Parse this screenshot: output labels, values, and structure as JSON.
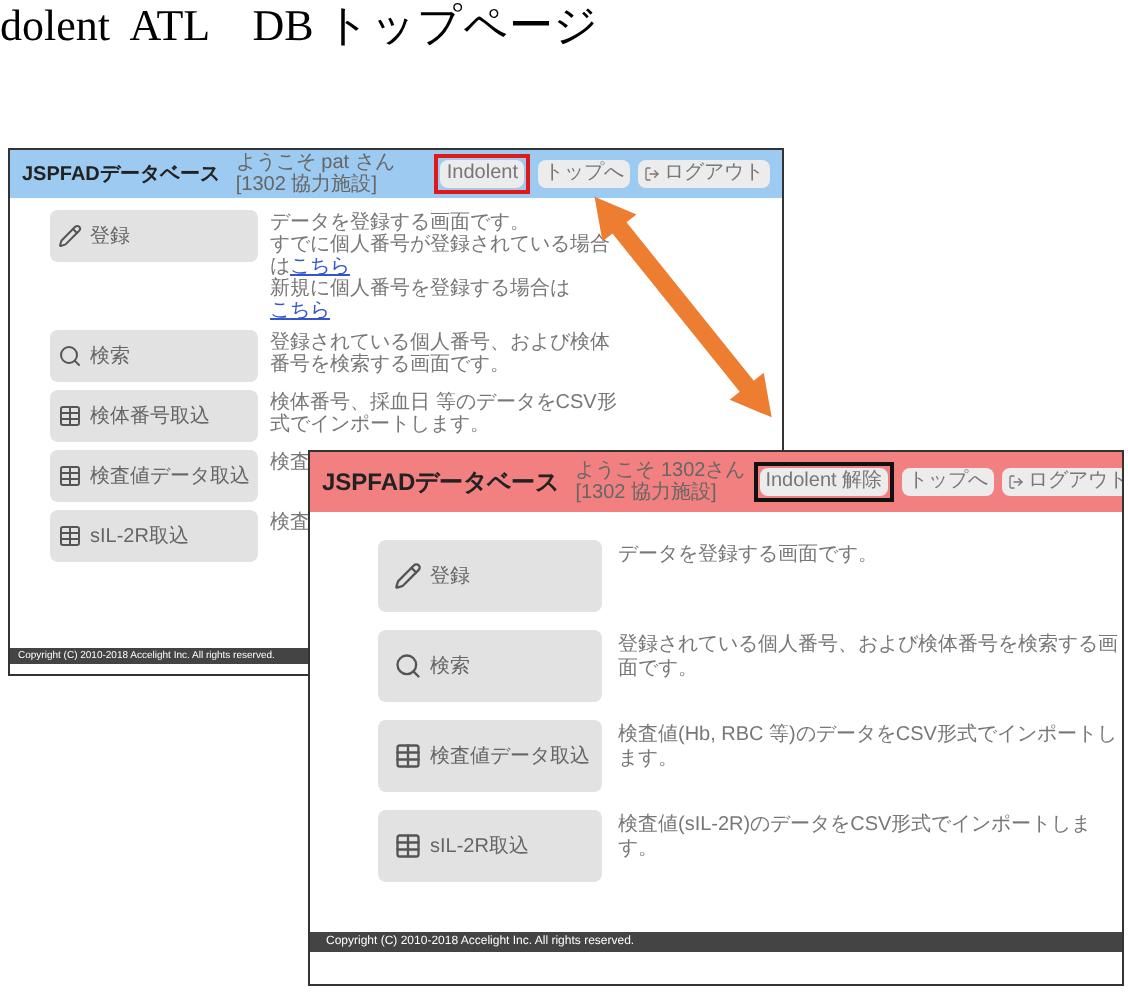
{
  "heading": "dolent  ATL　DB トップページ",
  "screenshots": [
    {
      "kind": "blue",
      "title": "JSPFADデータベース",
      "welcome": "ようこそ pat さん",
      "facility": "[1302 協力施設]",
      "header_buttons": [
        {
          "label": "Indolent",
          "highlighted": true,
          "icon": false
        },
        {
          "label": "トップへ",
          "highlighted": false,
          "icon": false
        },
        {
          "label": "ログアウト",
          "highlighted": false,
          "icon": true
        }
      ],
      "menu": [
        {
          "label": "登録",
          "kind": "pen",
          "description": [
            {
              "text": "データを登録する画面です。"
            },
            {
              "text": "すでに個人番号が登録されている場合は",
              "link": "こちら"
            },
            {
              "text": "新規に個人番号を登録する場合は",
              "link": "こちら"
            }
          ]
        },
        {
          "label": "検索",
          "kind": "search",
          "description": [
            {
              "text": "登録されている個人番号、および検体番号を検索する画面です。"
            }
          ]
        },
        {
          "label": "検体番号取込",
          "kind": "table",
          "description": [
            {
              "text": "検体番号、採血日 等のデータをCSV形式でインポートします。"
            }
          ]
        },
        {
          "label": "検査値データ取込",
          "kind": "table",
          "description": [
            {
              "text": "検査"
            }
          ]
        },
        {
          "label": "sIL-2R取込",
          "kind": "table",
          "description": [
            {
              "text": "検査"
            }
          ]
        }
      ],
      "footer": "Copyright (C) 2010-2018 Accelight Inc. All rights reserved."
    },
    {
      "kind": "pink",
      "title": "JSPFADデータベース",
      "welcome": "ようこそ 1302さん",
      "facility": "[1302 協力施設]",
      "header_buttons": [
        {
          "label": "Indolent 解除",
          "highlighted": true,
          "icon": false
        },
        {
          "label": "トップへ",
          "highlighted": false,
          "icon": false
        },
        {
          "label": "ログアウト",
          "highlighted": false,
          "icon": true
        }
      ],
      "menu": [
        {
          "label": "登録",
          "kind": "pen",
          "description": [
            {
              "text": "データを登録する画面です。"
            }
          ]
        },
        {
          "label": "検索",
          "kind": "search",
          "description": [
            {
              "text": "登録されている個人番号、および検体番号を検索する画面です。"
            }
          ]
        },
        {
          "label": "検査値データ取込",
          "kind": "table",
          "description": [
            {
              "text": "検査値(Hb, RBC 等)のデータをCSV形式でインポートします。"
            }
          ]
        },
        {
          "label": "sIL-2R取込",
          "kind": "table",
          "description": [
            {
              "text": "検査値(sIL-2R)のデータをCSV形式でインポートします。"
            }
          ]
        }
      ],
      "footer": "Copyright (C) 2010-2018 Accelight Inc. All rights reserved."
    }
  ]
}
